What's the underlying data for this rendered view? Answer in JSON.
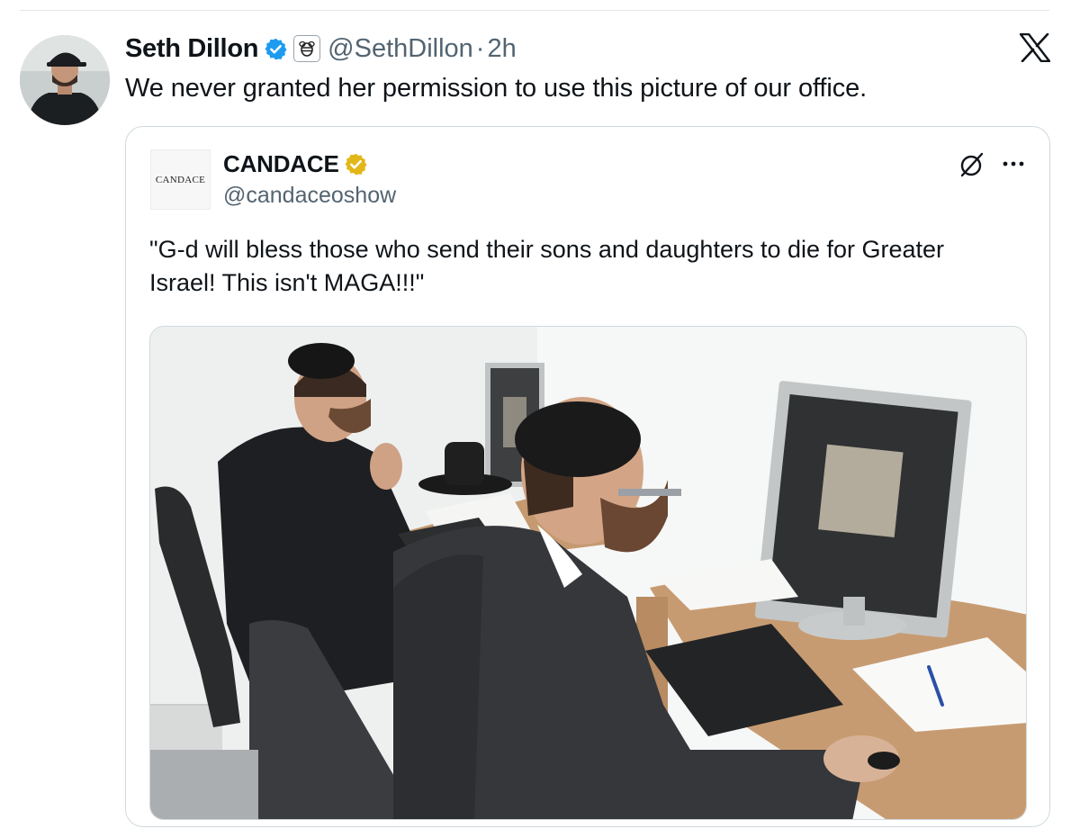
{
  "post": {
    "author_name": "Seth Dillon",
    "handle": "@SethDillon",
    "separator": "·",
    "time": "2h",
    "text": "We never granted her permission to use this picture of our office.",
    "verified_color": "#1d9bf0"
  },
  "quoted": {
    "avatar_text": "CANDACE",
    "author_name": "CANDACE",
    "handle": "@candaceoshow",
    "verified_color": "#e2b719",
    "text": "\"G-d will bless those who send their sons and daughters to die for Greater Israel! This isn't MAGA!!!\"",
    "image_alt": "Two men in black suits and kippahs working at computers in an office"
  },
  "icons": {
    "verified": "verified-check-icon",
    "affiliation": "babylon-bee-affiliate-icon",
    "close": "x-logo-icon",
    "grok": "grok-icon",
    "more": "more-options-icon"
  }
}
